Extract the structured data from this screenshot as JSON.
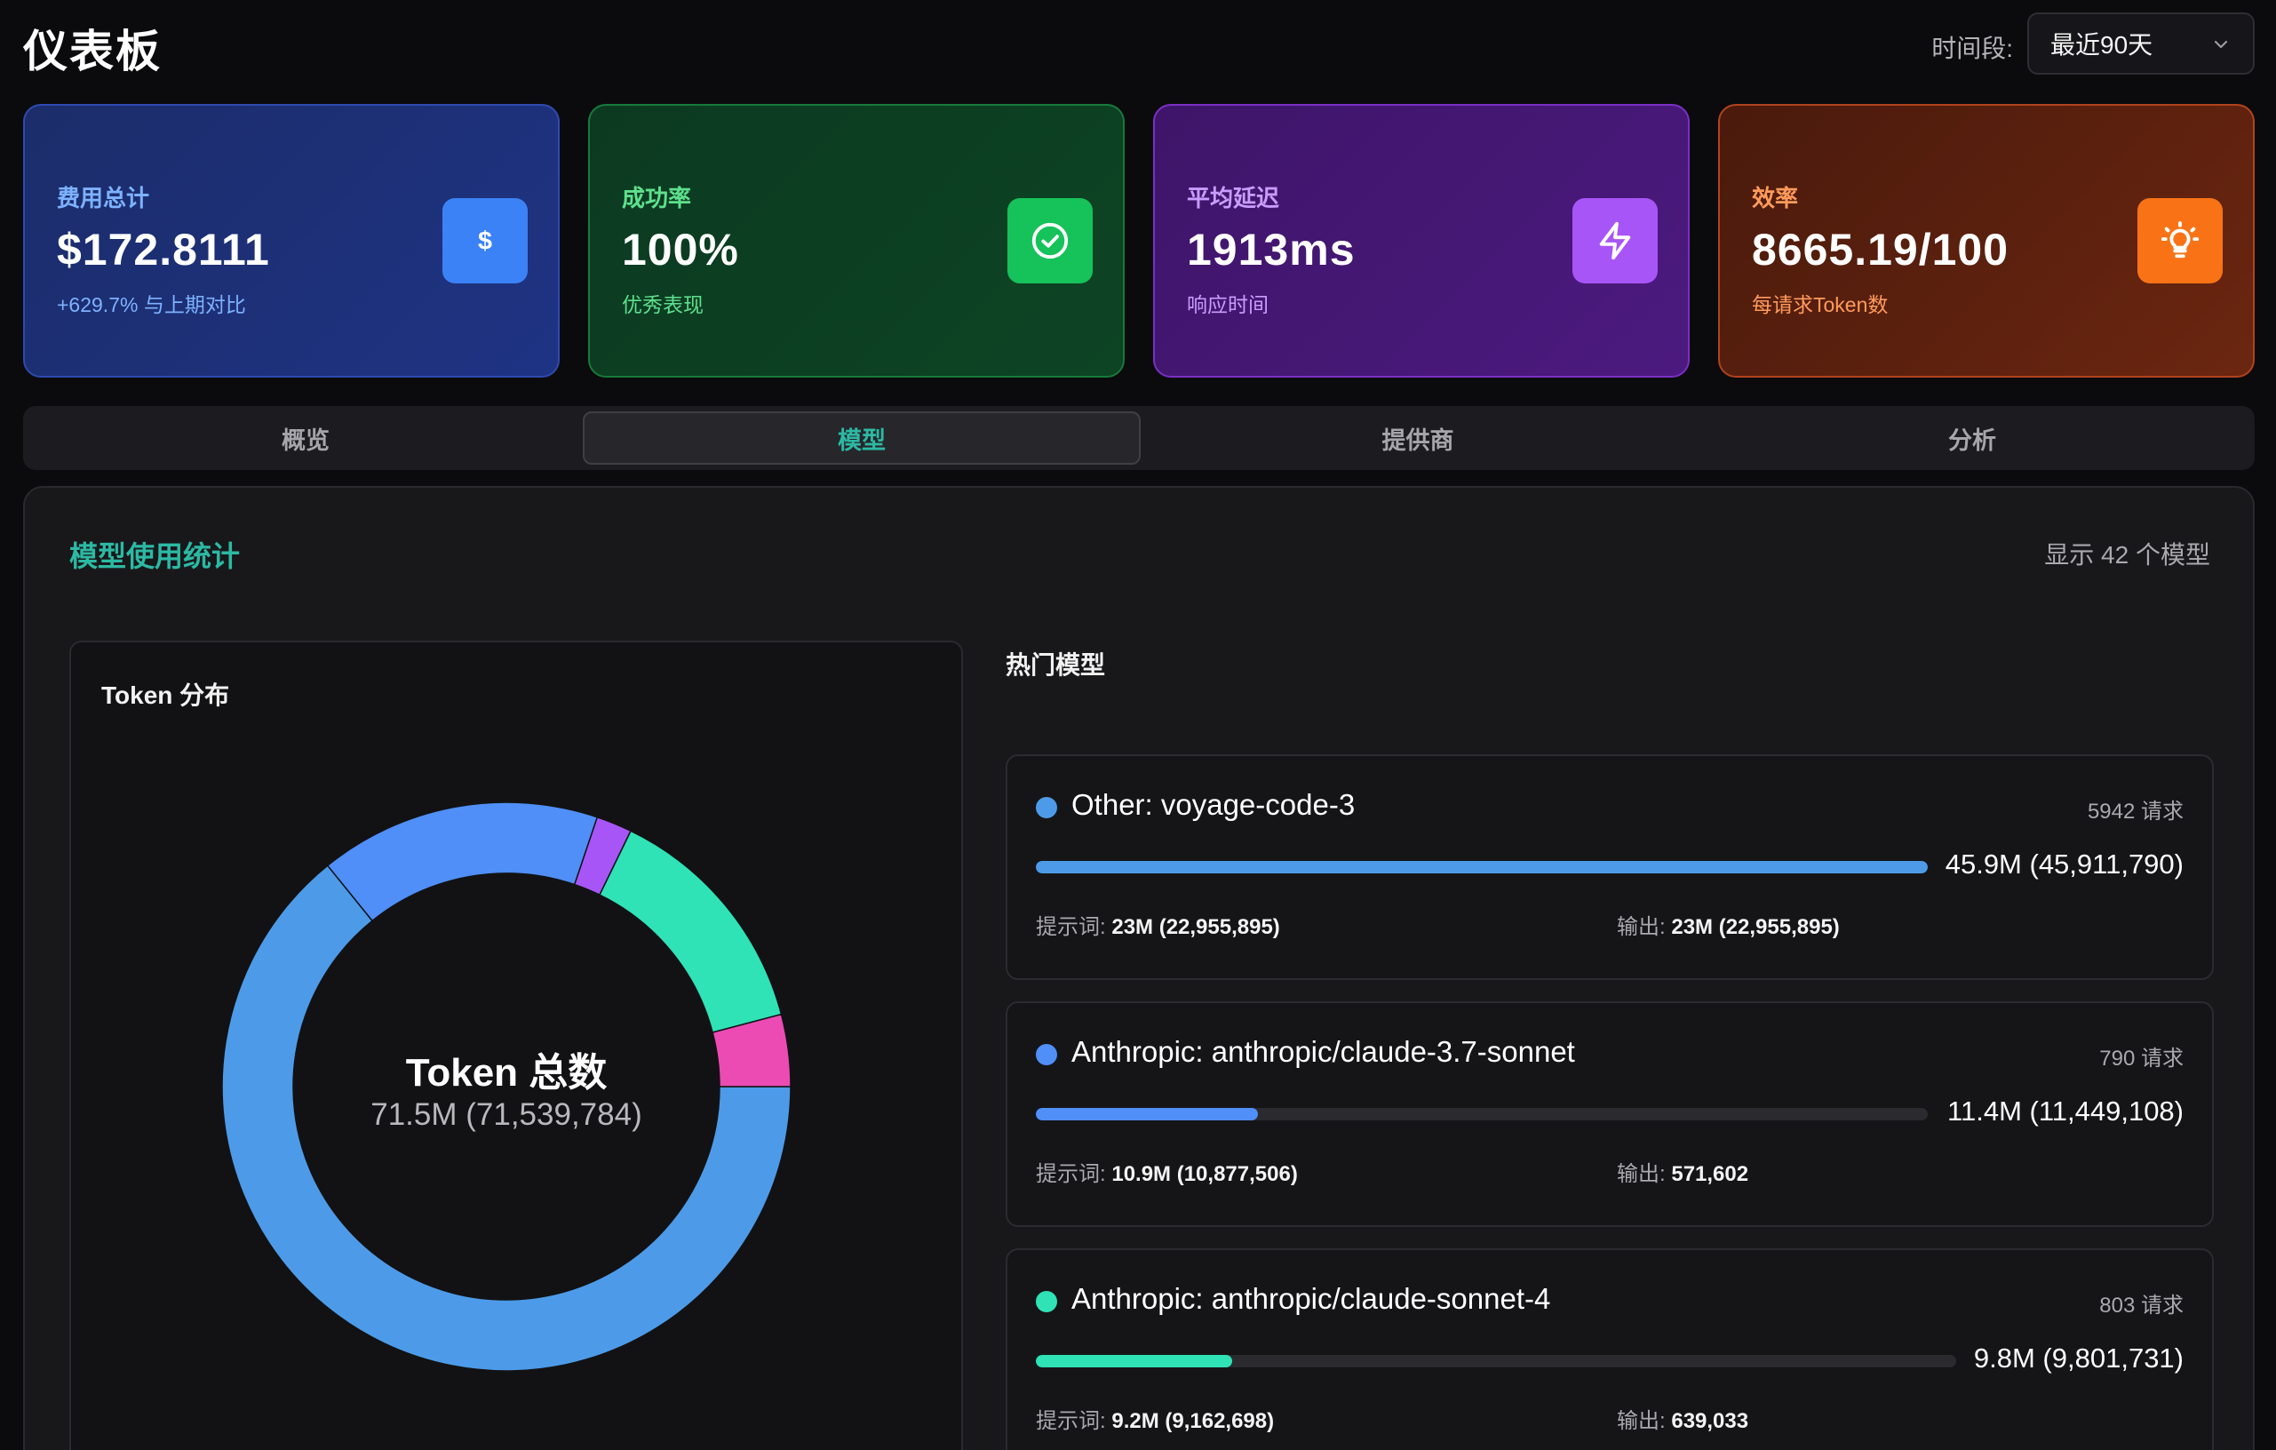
{
  "header": {
    "title": "仪表板",
    "period_label": "时间段:",
    "period_value": "最近90天"
  },
  "cards": [
    {
      "label": "费用总计",
      "value": "$172.8111",
      "sub": "+629.7% 与上期对比",
      "icon": "dollar-icon",
      "color": "#3b82f6"
    },
    {
      "label": "成功率",
      "value": "100%",
      "sub": "优秀表现",
      "icon": "check-circle-icon",
      "color": "#16c25a"
    },
    {
      "label": "平均延迟",
      "value": "1913ms",
      "sub": "响应时间",
      "icon": "lightning-icon",
      "color": "#a855f7"
    },
    {
      "label": "效率",
      "value": "8665.19/100",
      "sub": "每请求Token数",
      "icon": "lightbulb-icon",
      "color": "#f97316"
    }
  ],
  "tabs": [
    {
      "label": "概览",
      "active": false
    },
    {
      "label": "模型",
      "active": true
    },
    {
      "label": "提供商",
      "active": false
    },
    {
      "label": "分析",
      "active": false
    }
  ],
  "panel": {
    "title": "模型使用统计",
    "count_text": "显示 42 个模型"
  },
  "distribution": {
    "title": "Token 分布",
    "center_title": "Token 总数",
    "center_value": "71.5M (71,539,784)",
    "segments": [
      {
        "color": "#4d9be8",
        "value": 45911790
      },
      {
        "color": "#4f8ff7",
        "value": 11449108
      },
      {
        "color": "#a855f7",
        "value": 1450000
      },
      {
        "color": "#2fe3b6",
        "value": 9801731
      },
      {
        "color": "#ec4bb4",
        "value": 2927155
      }
    ]
  },
  "hot_models": {
    "title": "热门模型",
    "items": [
      {
        "dot_color": "#4d9be8",
        "name": "Other: voyage-code-3",
        "requests": "5942 请求",
        "total": "45.9M (45,911,790)",
        "share": 1.0,
        "prompt_label": "提示词:",
        "prompt_value": "23M (22,955,895)",
        "output_label": "输出:",
        "output_value": "23M (22,955,895)"
      },
      {
        "dot_color": "#4f8ff7",
        "name": "Anthropic: anthropic/claude-3.7-sonnet",
        "requests": "790 请求",
        "total": "11.4M (11,449,108)",
        "share": 0.249,
        "prompt_label": "提示词:",
        "prompt_value": "10.9M (10,877,506)",
        "output_label": "输出:",
        "output_value": "571,602"
      },
      {
        "dot_color": "#2fe3b6",
        "name": "Anthropic: anthropic/claude-sonnet-4",
        "requests": "803 请求",
        "total": "9.8M (9,801,731)",
        "share": 0.213,
        "prompt_label": "提示词:",
        "prompt_value": "9.2M (9,162,698)",
        "output_label": "输出:",
        "output_value": "639,033"
      }
    ]
  }
}
